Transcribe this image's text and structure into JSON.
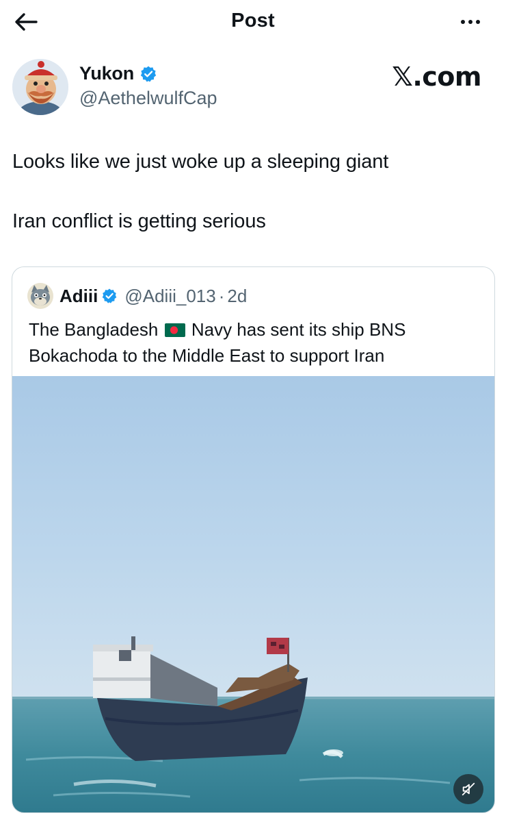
{
  "header": {
    "title": "Post",
    "back_icon": "arrow-left-icon",
    "more_icon": "more-horizontal-icon"
  },
  "author": {
    "name": "Yukon",
    "handle": "@AethelwulfCap",
    "verified": true,
    "avatar_icon": "cartoon-lumberjack-avatar"
  },
  "brand": {
    "label": "𝕏.com"
  },
  "post": {
    "lines": [
      "Looks like we just woke up a sleeping giant",
      "Iran conflict is getting serious"
    ]
  },
  "quoted_post": {
    "author_name": "Adiii",
    "verified": true,
    "handle": "@Adiii_013",
    "separator": "·",
    "time": "2d",
    "text_before_flag": "The Bangladesh",
    "flag_icon": "bangladesh-flag-icon",
    "text_after_flag": " Navy has sent its ship BNS Bokachoda to the Middle East to support Iran",
    "media": {
      "kind": "video",
      "mute_icon": "speaker-muted-icon"
    }
  },
  "colors": {
    "text": "#0f1419",
    "secondary_text": "#536471",
    "verified_blue": "#1d9bf0",
    "border": "#cfd9de",
    "flag_green": "#006a4e",
    "flag_red": "#f42a41"
  }
}
